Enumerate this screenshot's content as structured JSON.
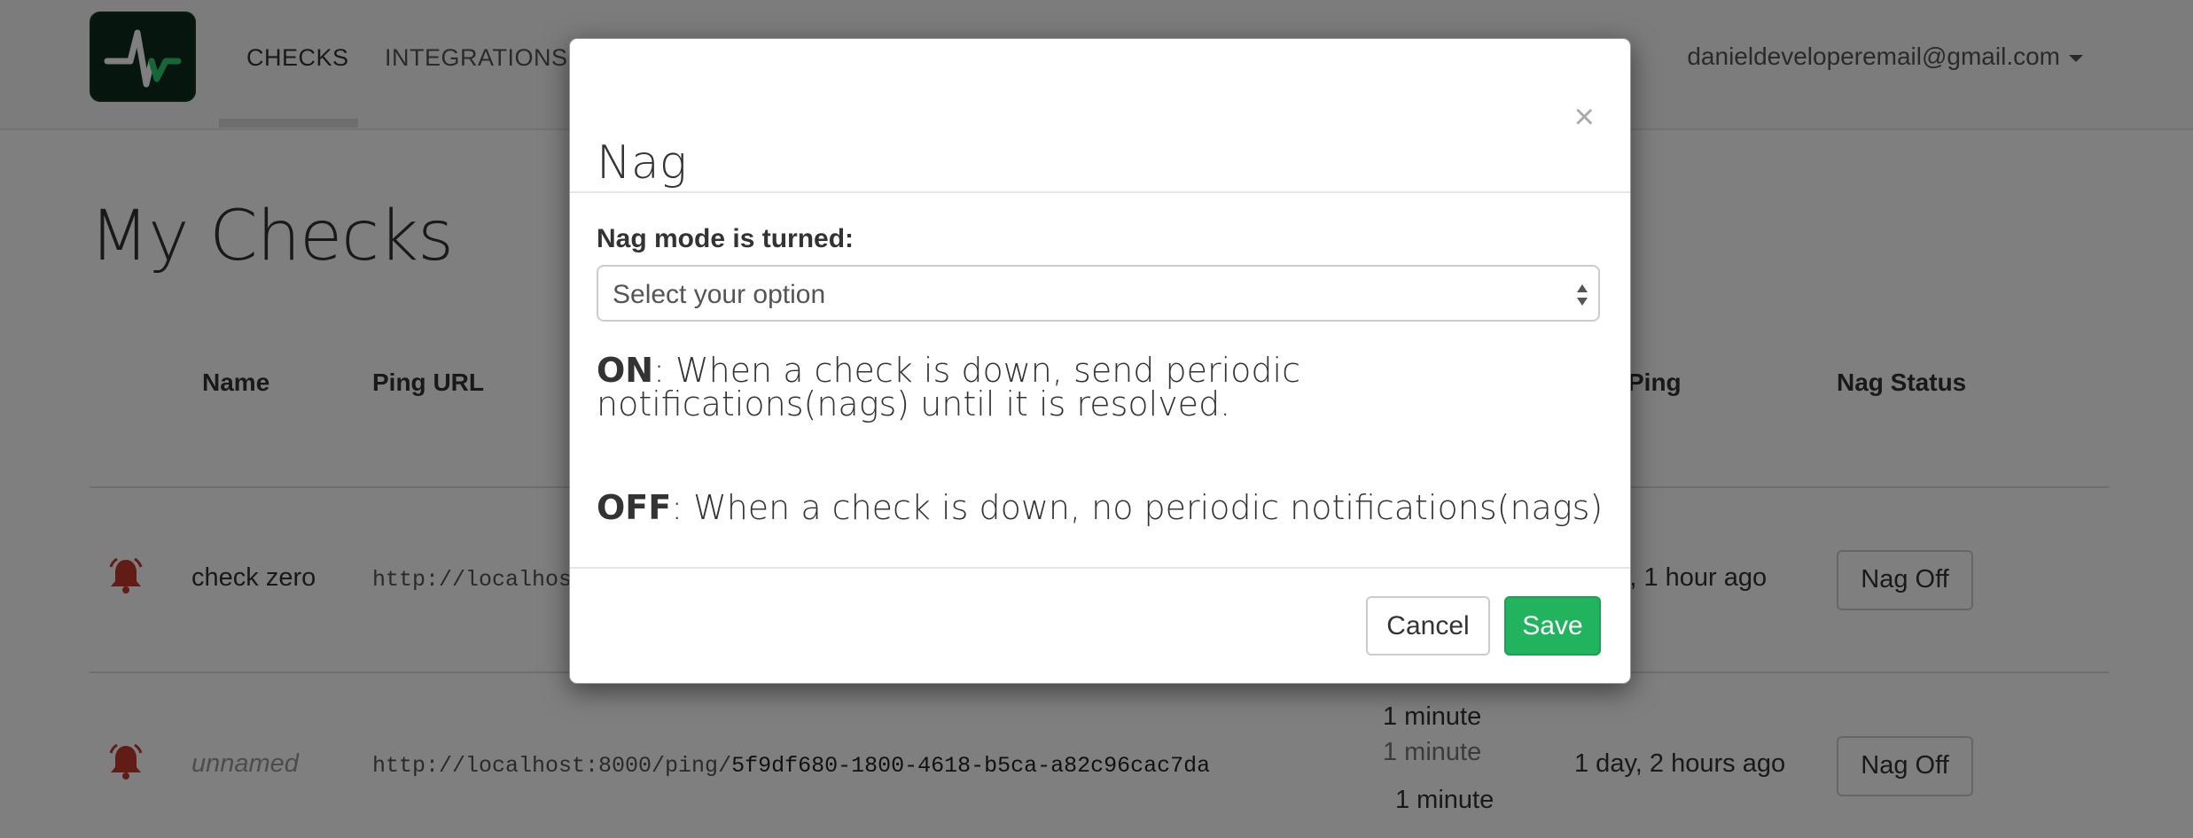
{
  "navbar": {
    "brand_icon": "healthchecks-logo-icon",
    "items": [
      {
        "label": "CHECKS",
        "active": true
      },
      {
        "label": "INTEGRATIONS",
        "active": false
      }
    ],
    "user_email": "danieldeveloperemail@gmail.com"
  },
  "page": {
    "title": "My Checks",
    "table": {
      "headers": {
        "name": "Name",
        "ping_url": "Ping URL",
        "last_ping": "Ping",
        "nag_status": "Nag Status"
      },
      "rows": [
        {
          "status_icon": "bell-icon",
          "name": "check zero",
          "ping_url_prefix": "http://localhost",
          "ping_url_code": "",
          "last_ping": "y, 1 hour ago",
          "nag_button": "Nag Off"
        },
        {
          "status_icon": "bell-icon",
          "name": "unnamed",
          "ping_url_prefix": "http://localhost:8000/ping/",
          "ping_url_code": "5f9df680-1800-4618-b5ca-a82c96cac7da",
          "period": "1 minute",
          "grace": "1 minute",
          "nag_interval": "1 minute",
          "last_ping": "1 day, 2 hours ago",
          "nag_button": "Nag Off"
        }
      ]
    }
  },
  "modal": {
    "title": "Nag",
    "close_glyph": "×",
    "field_label": "Nag mode is turned:",
    "select_value": "Select your option",
    "on_keyword": "ON",
    "on_text": ": When a check is down, send periodic notifications(nags) until it is resolved.",
    "off_keyword": "OFF",
    "off_text": ": When a check is down, no periodic notifications(nags)",
    "cancel_label": "Cancel",
    "save_label": "Save"
  },
  "colors": {
    "save_green": "#22b35f",
    "bell_red": "#c0392b",
    "logo_bg": "#0d2b1d"
  }
}
